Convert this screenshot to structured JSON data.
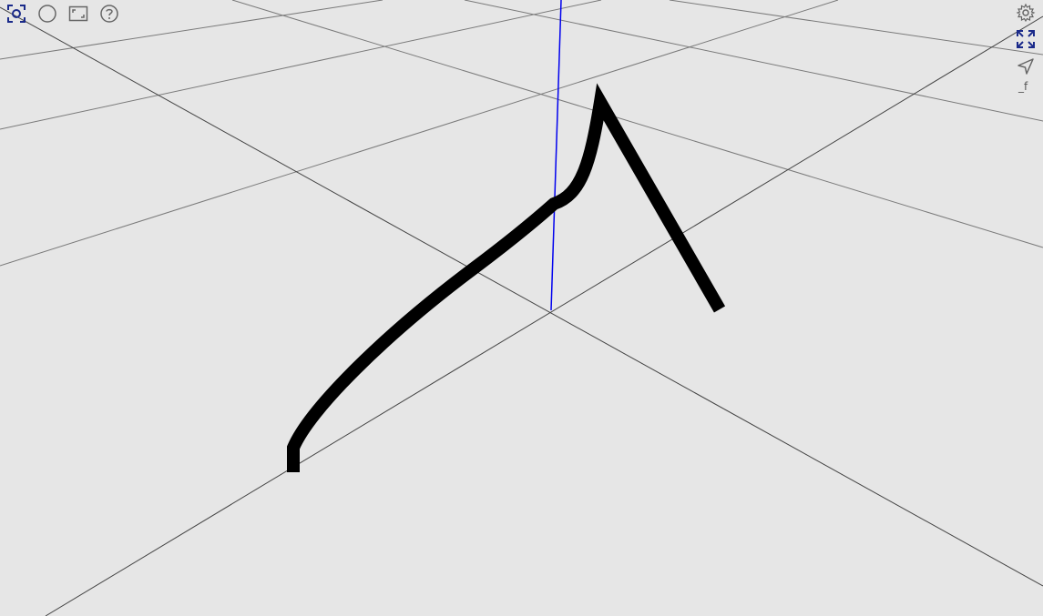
{
  "toolbar_left": [
    {
      "name": "reset-view-icon",
      "state": "active",
      "color": "#1a2a8a"
    },
    {
      "name": "circle-icon",
      "state": "inactive",
      "color": "#666666"
    },
    {
      "name": "frame-icon",
      "state": "inactive",
      "color": "#666666"
    },
    {
      "name": "help-icon",
      "state": "inactive",
      "color": "#666666"
    }
  ],
  "toolbar_right": [
    {
      "name": "gear-icon",
      "color": "#666666"
    },
    {
      "name": "fullscreen-icon",
      "color": "#1a2a8a"
    },
    {
      "name": "navigate-icon",
      "color": "#666666"
    }
  ],
  "scene": {
    "background": "#e6e6e6",
    "grid_color": "#7a7a7a",
    "axis_color": "#444444",
    "z_axis_color": "#0000ee",
    "curve_color": "#000000",
    "function_label": "_f"
  }
}
